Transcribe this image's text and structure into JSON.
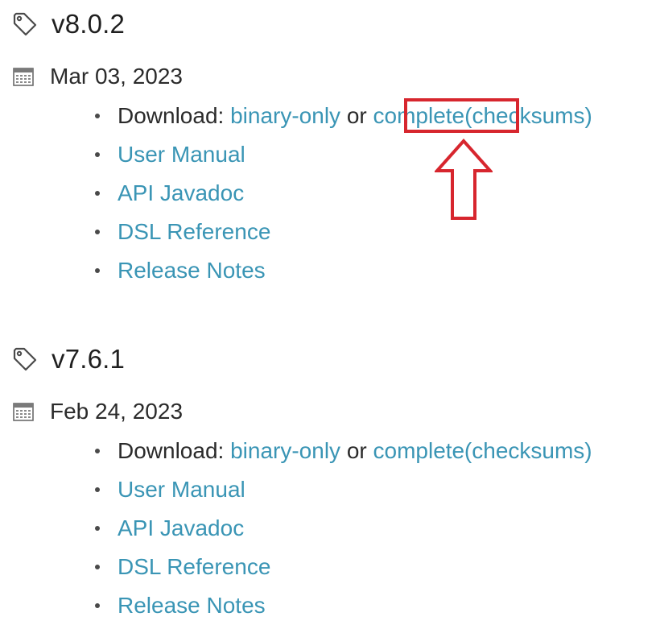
{
  "releases": [
    {
      "version": "v8.0.2",
      "date": "Mar 03, 2023",
      "download_label": "Download:",
      "binary_label": "binary-only",
      "or_label": "or",
      "complete_label": "complete",
      "open_paren": "(",
      "checksums_label": "checksums",
      "close_paren": ")",
      "user_manual": "User Manual",
      "api_javadoc": "API Javadoc",
      "dsl_reference": "DSL Reference",
      "release_notes": "Release Notes"
    },
    {
      "version": "v7.6.1",
      "date": "Feb 24, 2023",
      "download_label": "Download:",
      "binary_label": "binary-only",
      "or_label": "or",
      "complete_label": "complete",
      "open_paren": "(",
      "checksums_label": "checksums",
      "close_paren": ")",
      "user_manual": "User Manual",
      "api_javadoc": "API Javadoc",
      "dsl_reference": "DSL Reference",
      "release_notes": "Release Notes"
    }
  ],
  "icons": {
    "version": "tag-icon",
    "date": "calendar-icon",
    "annotation": "up-arrow-icon"
  },
  "colors": {
    "link": "#3a95b5",
    "text": "#2b2b2b",
    "highlight": "#d7262e"
  }
}
